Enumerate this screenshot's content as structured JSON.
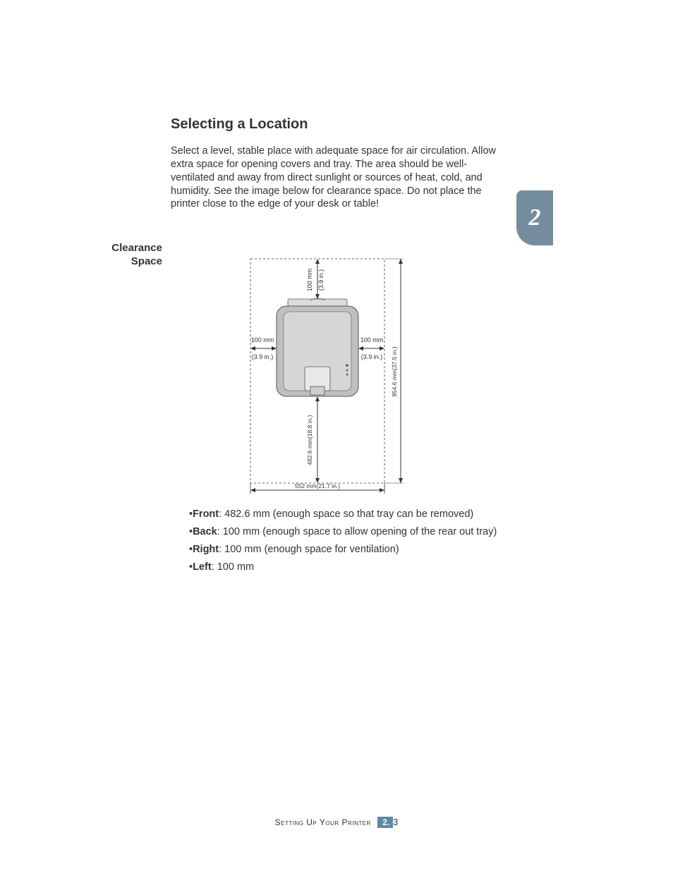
{
  "heading": "Selecting a Location",
  "intro": "Select a level, stable place with adequate space for air circulation. Allow extra space for opening covers and tray. The area should be well-ventilated and away from direct sunlight or sources of heat, cold, and humidity. See the image below for clearance space. Do not place the printer close to the edge of your desk or table!",
  "chapter_number": "2",
  "sidebar_label": "Clearance Space",
  "diagram": {
    "top_mm": "100 mm",
    "top_in": "(3.9 in.)",
    "left_mm": "100 mm",
    "left_in": "(3.9 in.)",
    "right_mm": "100 mm",
    "right_in": "(3.9 in.)",
    "front_label": "482.6 mm(18.8 in.)",
    "total_height_label": "954.6 mm(37.5 in.)",
    "total_width_label": "552 mm(21.7 in.)"
  },
  "bullets": {
    "front_label": "Front",
    "front_text": ": 482.6 mm (enough space so that tray can be removed)",
    "back_label": "Back",
    "back_text": ": 100 mm (enough space to allow opening of the rear out tray)",
    "right_label": "Right",
    "right_text": ": 100 mm (enough space for ventilation)",
    "left_label": "Left",
    "left_text": ": 100 mm"
  },
  "footer": {
    "section": "Setting Up Your Printer",
    "chapter": "2.",
    "page": "3"
  }
}
